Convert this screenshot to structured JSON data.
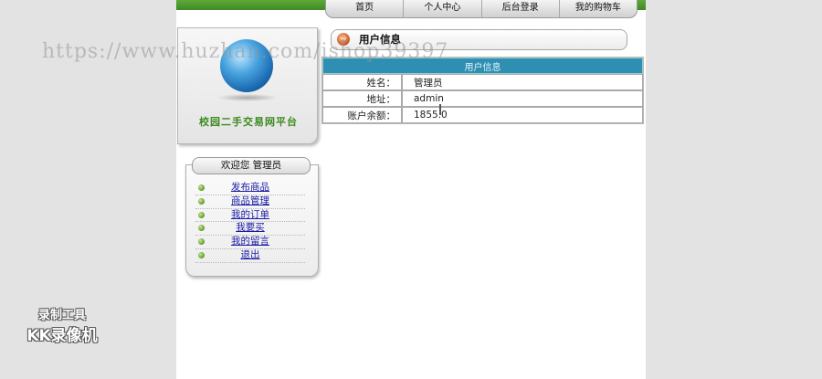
{
  "nav": {
    "items": [
      "首页",
      "个人中心",
      "后台登录",
      "我的购物车"
    ]
  },
  "logo": {
    "text": "校园二手交易网平台"
  },
  "sidebar": {
    "welcome": "欢迎您 管理员",
    "items": [
      "发布商品",
      "商品管理",
      "我的订单",
      "我要买",
      "我的留言",
      "退出"
    ]
  },
  "main": {
    "section_title": "用户信息",
    "table_header": "用户信息",
    "rows": [
      {
        "label": "姓名：",
        "value": "管理员"
      },
      {
        "label": "地址：",
        "value": "admin"
      },
      {
        "label": "账户余额：",
        "value": "1855.0"
      }
    ]
  },
  "overlay": {
    "watermark": "https://www.huzhan.com/ishop39397",
    "recorder_line1": "录制工具",
    "recorder_line2": "KK录像机"
  },
  "colors": {
    "brand_green": "#3f8a22",
    "table_header_blue": "#2f8fb2",
    "link_blue": "#1a1aa6"
  },
  "icons": {
    "title_icon": "arrow-circle-icon",
    "menu_bullet": "green-dot-icon"
  }
}
